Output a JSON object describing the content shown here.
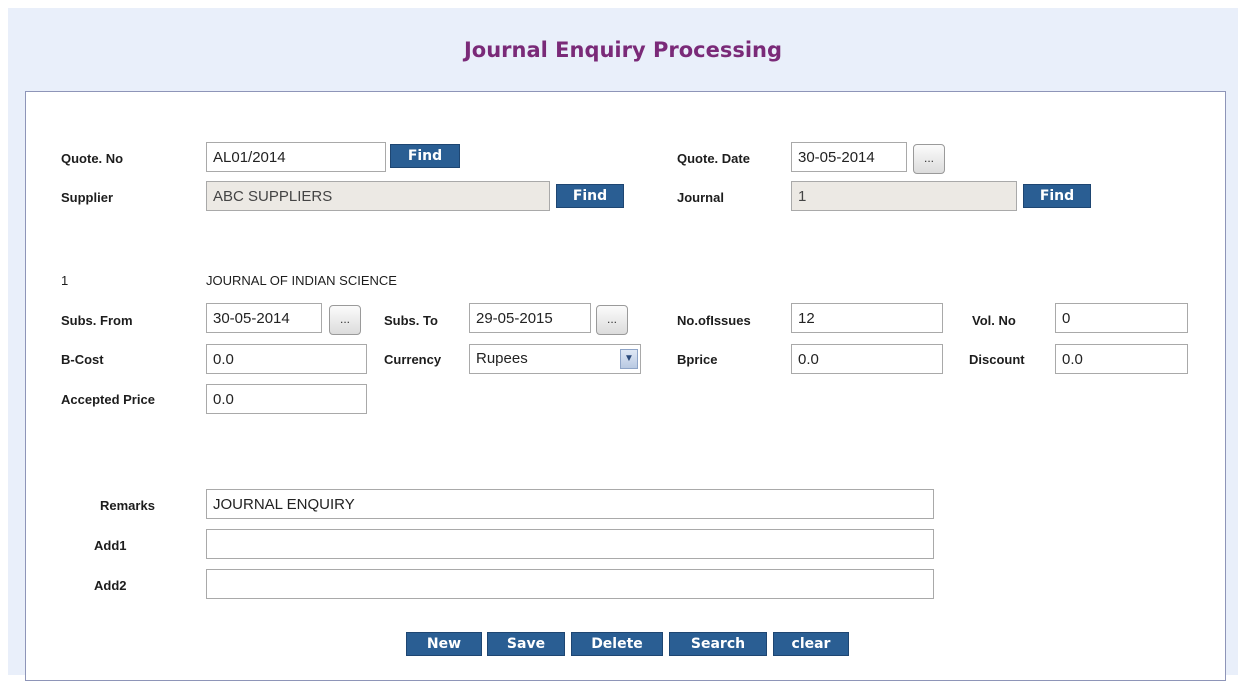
{
  "title": "Journal Enquiry Processing",
  "labels": {
    "quote_no": "Quote. No",
    "supplier": "Supplier",
    "quote_date": "Quote. Date",
    "journal": "Journal",
    "subs_from": "Subs. From",
    "subs_to": "Subs. To",
    "no_of_issues": "No.ofIssues",
    "vol_no": "Vol. No",
    "b_cost": "B-Cost",
    "currency": "Currency",
    "bprice": "Bprice",
    "discount": "Discount",
    "accepted_price": "Accepted Price",
    "remarks": "Remarks",
    "add1": "Add1",
    "add2": "Add2"
  },
  "values": {
    "quote_no": "AL01/2014",
    "supplier": "ABC SUPPLIERS",
    "quote_date": "30-05-2014",
    "journal": "1",
    "journal_id": "1",
    "journal_name": "JOURNAL OF INDIAN SCIENCE",
    "subs_from": "30-05-2014",
    "subs_to": "29-05-2015",
    "no_of_issues": "12",
    "vol_no": "0",
    "b_cost": "0.0",
    "currency": "Rupees",
    "bprice": "0.0",
    "discount": "0.0",
    "accepted_price": "0.0",
    "remarks": "JOURNAL ENQUIRY",
    "add1": "",
    "add2": ""
  },
  "buttons": {
    "find": "Find",
    "date_picker": "...",
    "new": "New",
    "save": "Save",
    "delete": "Delete",
    "search": "Search",
    "clear": "clear"
  },
  "icons": {
    "dropdown": "chevron-down-icon"
  },
  "colors": {
    "title": "#7a2a78",
    "button_bg": "#2a5e93",
    "page_bg": "#e9effa"
  }
}
